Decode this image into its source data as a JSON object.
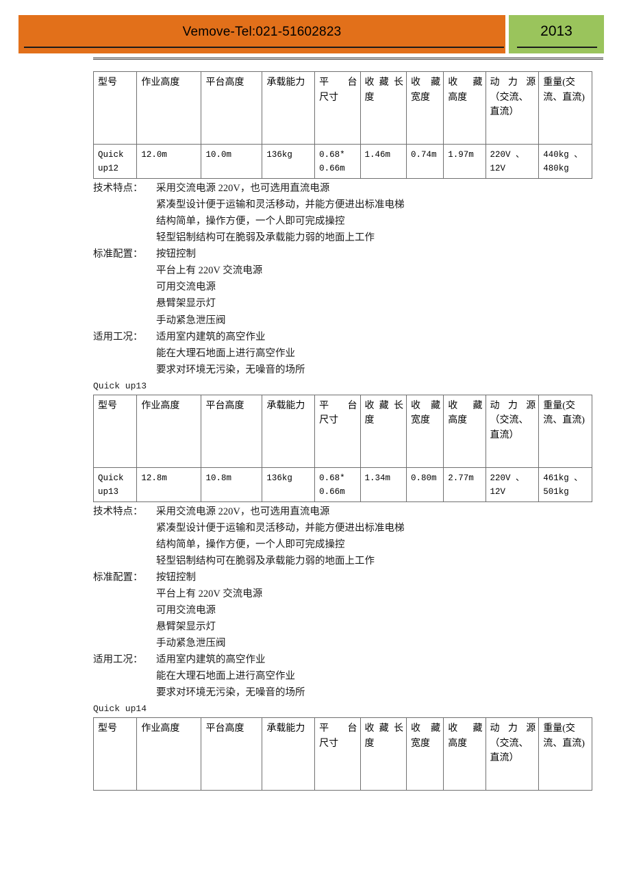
{
  "header": {
    "banner_text": "Vemove-Tel:021-51602823",
    "year": "2013",
    "orange_color": "#e2701a",
    "green_color": "#9ac45c"
  },
  "table_columns": [
    "型号",
    "作业高度",
    "平台高度",
    "承载能力",
    "平 台\n尺寸",
    "收 藏 长\n度",
    "收 藏\n宽度",
    "收 藏\n高度",
    "动 力 源\n（交流、\n直流）",
    "重量(交\n流、直流)"
  ],
  "table_columns_parts": {
    "c0": [
      "型号"
    ],
    "c1": [
      "作业高度"
    ],
    "c2": [
      "平台高度"
    ],
    "c3": [
      "承载能力"
    ],
    "c4": [
      "平 台",
      "尺寸"
    ],
    "c5": [
      "收 藏 长",
      "度"
    ],
    "c6": [
      "收 藏",
      "宽度"
    ],
    "c7": [
      "收 藏",
      "高度"
    ],
    "c8": [
      "动 力 源",
      "（交流、",
      "直流）"
    ],
    "c9": [
      "重量(交",
      "流、直流)"
    ]
  },
  "sections": [
    {
      "caption": "",
      "row": {
        "model_l1": "Quick",
        "model_l2": "up12",
        "work_height": "12.0m",
        "platform_height": "10.0m",
        "capacity": "136kg",
        "platform_size_l1": "0.68*",
        "platform_size_l2": "0.66m",
        "stow_length": "1.46m",
        "stow_width": "0.74m",
        "stow_height": "1.97m",
        "power_l1": "220V 、",
        "power_l2": "12V",
        "weight_l1": "440kg 、",
        "weight_l2": "480kg"
      },
      "notes": [
        {
          "label": "技术特点：",
          "lines": [
            "采用交流电源 220V，也可选用直流电源",
            "紧凑型设计便于运输和灵活移动，并能方便进出标准电梯",
            "结构简单，操作方便，一个人即可完成操控",
            "轻型铝制结构可在脆弱及承载能力弱的地面上工作"
          ]
        },
        {
          "label": "标准配置：",
          "lines": [
            "按钮控制",
            "平台上有 220V 交流电源",
            "可用交流电源",
            "悬臂架显示灯",
            "手动紧急泄压阀"
          ]
        },
        {
          "label": "适用工况：",
          "lines": [
            "适用室内建筑的高空作业",
            "能在大理石地面上进行高空作业",
            "要求对环境无污染，无噪音的场所"
          ]
        }
      ]
    },
    {
      "caption": "Quick up13",
      "row": {
        "model_l1": "Quick",
        "model_l2": "up13",
        "work_height": "12.8m",
        "platform_height": "10.8m",
        "capacity": "136kg",
        "platform_size_l1": "0.68*",
        "platform_size_l2": "0.66m",
        "stow_length": "1.34m",
        "stow_width": "0.80m",
        "stow_height": "2.77m",
        "power_l1": "220V 、",
        "power_l2": "12V",
        "weight_l1": "461kg 、",
        "weight_l2": "501kg"
      },
      "notes": [
        {
          "label": "技术特点：",
          "lines": [
            "采用交流电源 220V，也可选用直流电源",
            "紧凑型设计便于运输和灵活移动，并能方便进出标准电梯",
            "结构简单，操作方便，一个人即可完成操控",
            "轻型铝制结构可在脆弱及承载能力弱的地面上工作"
          ]
        },
        {
          "label": "标准配置：",
          "lines": [
            "按钮控制",
            "平台上有 220V 交流电源",
            "可用交流电源",
            "悬臂架显示灯",
            "手动紧急泄压阀"
          ]
        },
        {
          "label": "适用工况：",
          "lines": [
            "适用室内建筑的高空作业",
            "能在大理石地面上进行高空作业",
            "要求对环境无污染，无噪音的场所"
          ]
        }
      ]
    },
    {
      "caption": "Quick up14",
      "row": null,
      "notes": []
    }
  ]
}
